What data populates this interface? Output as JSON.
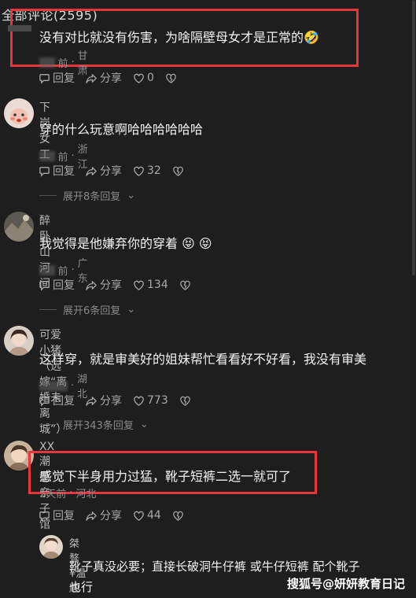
{
  "header": {
    "title": "全部评论(2595)"
  },
  "comments": [
    {
      "user": "",
      "text": "没有对比就没有伤害，为啥隔壁母女才是正常的🤣",
      "time": "前",
      "location": "甘肃",
      "reply_label": "回复",
      "share_label": "分享",
      "likes": "0"
    },
    {
      "user": "下岗女工",
      "text": "穿的什么玩意啊哈哈哈哈哈哈",
      "time": "前",
      "location": "浙江",
      "reply_label": "回复",
      "share_label": "分享",
      "likes": "32",
      "expand_label": "展开8条回复"
    },
    {
      "user": "醉卧山河间",
      "text": "我觉得是他嫌弃你的穿着 😝 😝",
      "time": "前",
      "location": "广东",
      "reply_label": "回复",
      "share_label": "分享",
      "likes": "134",
      "expand_label": "展开6条回复"
    },
    {
      "user": "可爱小猪（远嫁“离婚未离城”）",
      "text": "这样穿，就是审美好的姐妹帮忙看看好不好看，我没有审美",
      "time": "",
      "location": "湖北",
      "reply_label": "回复",
      "share_label": "分享",
      "likes": "773",
      "expand_label": "展开343条回复"
    },
    {
      "user": "XX潮童亲子馆",
      "text": "感觉下半身用力过猛，靴子短裤二选一就可了",
      "time": "5天前",
      "location": "河北",
      "reply_label": "回复",
      "share_label": "分享",
      "likes": "44"
    }
  ],
  "reply": {
    "user": "桀骜¥温顺",
    "text_line1": "靴子真没必要；直接长破洞牛仔裤 或牛仔短裤 配个靴子",
    "text_line2": "也行"
  },
  "watermark": "搜狐号@妍妍教育日记",
  "colors": {
    "background": "#1e1e1e",
    "highlight": "#e8353b",
    "text": "#f2f2f2",
    "muted": "#8e8e8e"
  }
}
